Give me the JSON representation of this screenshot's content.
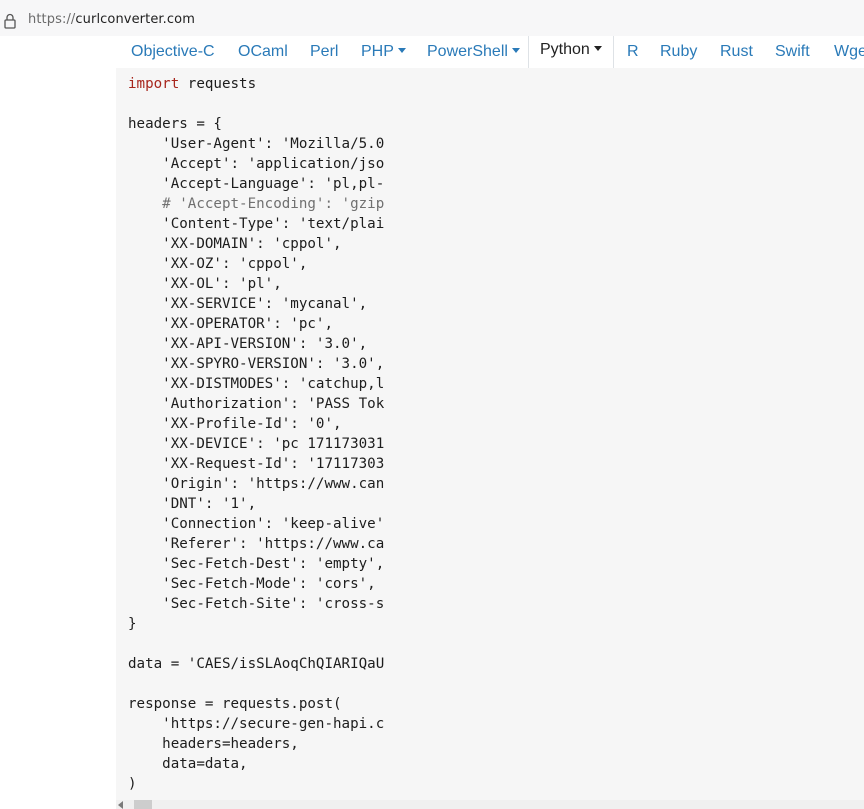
{
  "browser": {
    "url_scheme": "https://",
    "url_host": "curlconverter.com",
    "lock_icon": "lock-icon"
  },
  "tabs": [
    {
      "label": "Objective-C",
      "dropdown": false
    },
    {
      "label": "OCaml",
      "dropdown": false
    },
    {
      "label": "Perl",
      "dropdown": false
    },
    {
      "label": "PHP",
      "dropdown": true
    },
    {
      "label": "PowerShell",
      "dropdown": true
    },
    {
      "label": "Python",
      "dropdown": true,
      "active": true
    },
    {
      "label": "R",
      "dropdown": false
    },
    {
      "label": "Ruby",
      "dropdown": false
    },
    {
      "label": "Swift",
      "dropdown": false
    },
    {
      "label": "Rust",
      "dropdown": false
    },
    {
      "label": "Wge",
      "dropdown": false
    }
  ],
  "code": {
    "import_kw": "import",
    "import_rest": " requests",
    "headers_open": "headers = {",
    "header_lines": [
      "    'User-Agent': 'Mozilla/5.0",
      "    'Accept': 'application/jso",
      "    'Accept-Language': 'pl,pl-",
      "    'Content-Type': 'text/plai",
      "    'XX-DOMAIN': 'cppol',",
      "    'XX-OZ': 'cppol',",
      "    'XX-OL': 'pl',",
      "    'XX-SERVICE': 'mycanal',",
      "    'XX-OPERATOR': 'pc',",
      "    'XX-API-VERSION': '3.0',",
      "    'XX-SPYRO-VERSION': '3.0',",
      "    'XX-DISTMODES': 'catchup,l",
      "    'Authorization': 'PASS Tok",
      "    'XX-Profile-Id': '0',",
      "    'XX-DEVICE': 'pc 171173031",
      "    'XX-Request-Id': '17117303",
      "    'Origin': 'https://www.can",
      "    'DNT': '1',",
      "    'Connection': 'keep-alive'",
      "    'Referer': 'https://www.ca",
      "    'Sec-Fetch-Dest': 'empty',",
      "    'Sec-Fetch-Mode': 'cors',",
      "    'Sec-Fetch-Site': 'cross-s"
    ],
    "comment_line": "    # 'Accept-Encoding': 'gzip",
    "headers_close": "}",
    "data_line": "data = 'CAES/isSLAoqChQIARIQaU",
    "response_open": "response = requests.post(",
    "post_url": "    'https://secure-gen-hapi.c",
    "post_headers": "    headers=headers,",
    "post_data": "    data=data,",
    "response_close": ")"
  },
  "colors": {
    "tab_link": "#2a7ab8",
    "keyword": "#a7261d",
    "code_bg": "#f6f6f6"
  }
}
